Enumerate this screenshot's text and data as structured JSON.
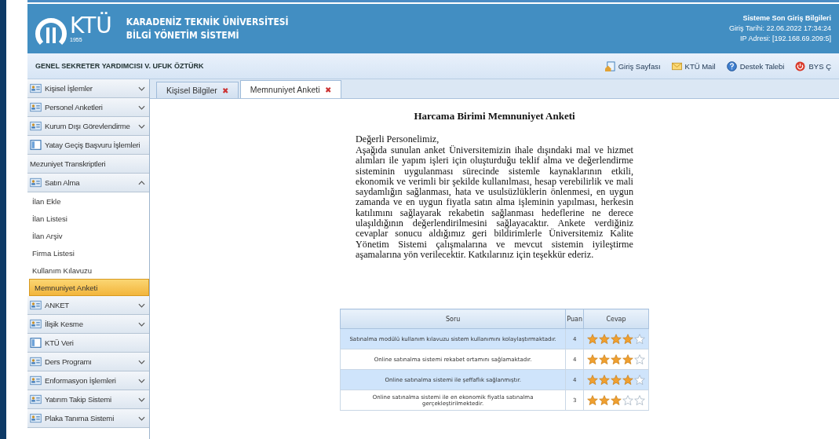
{
  "header": {
    "logo": {
      "text": "KTÜ",
      "year": "1955"
    },
    "title_lines": [
      "KARADENİZ TEKNİK ÜNİVERSİTESİ",
      "BİLGİ YÖNETİM SİSTEMİ"
    ],
    "login_info": {
      "title": "Sisteme Son Giriş Bilgileri",
      "date": "Giriş Tarihi: 22.06.2022 17:34:24",
      "ip": "IP Adresi: [192.168.69.209:5]"
    }
  },
  "user_bar": {
    "user": "GENEL SEKRETER YARDIMCISI V. UFUK ÖZTÜRK",
    "links": [
      {
        "kind": "home",
        "label": "Giriş Sayfası"
      },
      {
        "kind": "mail",
        "label": "KTÜ Mail"
      },
      {
        "kind": "help",
        "label": "Destek Talebi"
      },
      {
        "kind": "power",
        "label": "BYS Ç"
      }
    ]
  },
  "sidebar": {
    "items": [
      {
        "kind": "group",
        "label": "Kişisel İşlemler",
        "expanded": false
      },
      {
        "kind": "group",
        "label": "Personel Anketleri",
        "expanded": false
      },
      {
        "kind": "group",
        "label": "Kurum Dışı Görevlendirme",
        "expanded": false
      },
      {
        "kind": "page",
        "label": "Yatay Geçiş Başvuru İşlemleri"
      },
      {
        "kind": "label",
        "label": "Mezuniyet Transkriptleri"
      },
      {
        "kind": "group",
        "label": "Satın Alma",
        "expanded": true,
        "children": [
          {
            "label": "İlan Ekle",
            "selected": false
          },
          {
            "label": "İlan Listesi",
            "selected": false
          },
          {
            "label": "İlan Arşiv",
            "selected": false
          },
          {
            "label": "Firma Listesi",
            "selected": false
          },
          {
            "label": "Kullanım Kılavuzu",
            "selected": false
          },
          {
            "label": "Memnuniyet Anketi",
            "selected": true
          }
        ]
      },
      {
        "kind": "group",
        "label": "ANKET",
        "expanded": false
      },
      {
        "kind": "group",
        "label": "İlişik Kesme",
        "expanded": false
      },
      {
        "kind": "page",
        "label": "KTÜ Veri"
      },
      {
        "kind": "group",
        "label": "Ders Programı",
        "expanded": false
      },
      {
        "kind": "group",
        "label": "Enformasyon İşlemleri",
        "expanded": false
      },
      {
        "kind": "group",
        "label": "Yatırım Takip Sistemi",
        "expanded": false
      },
      {
        "kind": "group",
        "label": "Plaka Tanıma Sistemi",
        "expanded": false
      }
    ]
  },
  "tabs": [
    {
      "label": "Kişisel Bilgiler",
      "close": "✖",
      "selected": false
    },
    {
      "label": "Memnuniyet Anketi",
      "close": "✖",
      "selected": true
    }
  ],
  "survey": {
    "title": "Harcama Birimi Memnuniyet Anketi",
    "greeting": "Değerli Personelimiz,",
    "intro": "Aşağıda sunulan anket Üniversitemizin ihale dışındaki mal ve hizmet alımları ile yapım işleri için oluşturduğu teklif alma ve değerlendirme sisteminin uygulanması sürecinde sistemle kaynaklarının etkili, ekonomik ve verimli bir şekilde kullanılması, hesap verebilirlik ve mali saydamlığın sağlanması, hata ve usulsüzlüklerin önlenmesi, en uygun zamanda ve en uygun fiyatla satın alma işleminin yapılması, herkesin katılımını sağlayarak rekabetin sağlanması hedeflerine ne derece ulaşıldığının değerlendirilmesini sağlayacaktır. Ankete verdiğiniz cevaplar sonucu aldığımız geri bildirimlerle Üniversitemiz Kalite Yönetim Sistemi çalışmalarına ve mevcut sistemin iyileştirme aşamalarına yön verilecektir. Katkılarınız için teşekkür ederiz.",
    "table": {
      "columns": [
        "Soru",
        "Puan",
        "Cevap"
      ],
      "rows": [
        {
          "question": "Satınalma modülü kullanım kılavuzu sistem kullanımını kolaylaştırmaktadır.",
          "score": "4",
          "stars": 4
        },
        {
          "question": "Online satınalma sistemi rekabet ortamını sağlamaktadır.",
          "score": "4",
          "stars": 4
        },
        {
          "question": "Online satınalma sistemi ile şeffaflık sağlanmıştır.",
          "score": "4",
          "stars": 4
        },
        {
          "question": "Online satınalma sistemi ile en ekonomik fiyatla satınalma gerçekleştirilmektedir.",
          "score": "3",
          "stars": 3
        }
      ]
    }
  }
}
